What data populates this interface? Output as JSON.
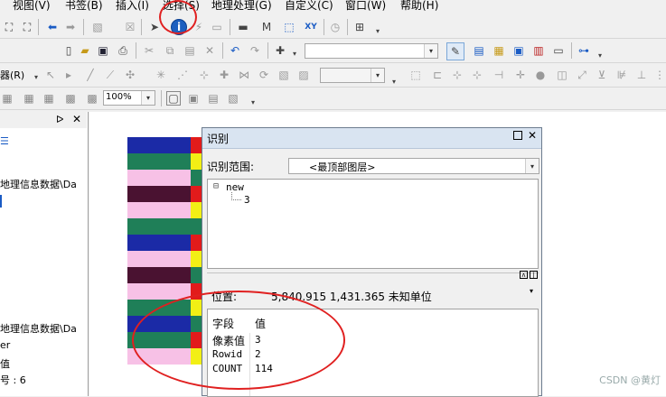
{
  "menubar": {
    "items": [
      "视图(V)",
      "书签(B)",
      "插入(I)",
      "选择(S)",
      "地理处理(G)",
      "自定义(C)",
      "窗口(W)",
      "帮助(H)"
    ]
  },
  "toolbar": {
    "zoom_value": "100%",
    "labeling_label": "器(R)"
  },
  "toc": {
    "lines": [
      "地理信息数据\\Da",
      "地理信息数据\\Da",
      "er",
      "值",
      "号 : 6"
    ]
  },
  "identify": {
    "title": "识别",
    "scope_label": "识别范围:",
    "scope_value": "<最顶部图层>",
    "tree_root": "new",
    "tree_child": "3",
    "location_label": "位置:",
    "location_value": "5,840.915  1,431.365 未知单位",
    "table": {
      "headers": [
        "字段",
        "值"
      ],
      "rows": [
        {
          "field": "像素值",
          "value": "3"
        },
        {
          "field": "Rowid",
          "value": "2"
        },
        {
          "field": "COUNT",
          "value": "114"
        }
      ]
    }
  },
  "map": {
    "stripes": [
      "#1b2aa6",
      "#1f7f58",
      "#f7c1e6",
      "#4a1231",
      "#f7c1e6",
      "#1f7f58",
      "#1b2aa6",
      "#f7c1e6",
      "#4a1231",
      "#f7c1e6",
      "#1f7f58",
      "#1b2aa6",
      "#1f7f58",
      "#f7c1e6"
    ]
  },
  "watermark": "CSDN @黄灯",
  "colors": {
    "annotation": "#e02020",
    "title_bar": "#d9e4f1"
  }
}
